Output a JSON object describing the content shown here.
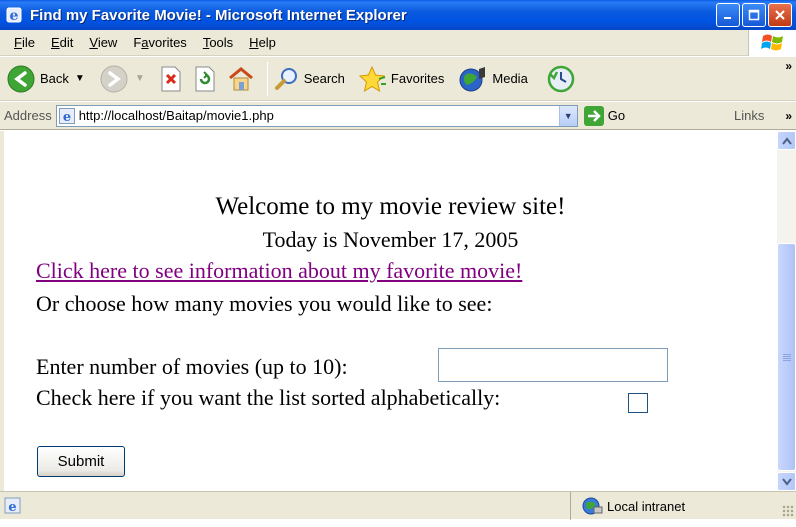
{
  "window": {
    "title": "Find my Favorite Movie! - Microsoft Internet Explorer"
  },
  "menu": {
    "items": [
      "File",
      "Edit",
      "View",
      "Favorites",
      "Tools",
      "Help"
    ],
    "mnemonics": [
      "F",
      "E",
      "V",
      "a",
      "T",
      "H"
    ]
  },
  "toolbar": {
    "back_label": "Back",
    "search_label": "Search",
    "favorites_label": "Favorites",
    "media_label": "Media"
  },
  "address": {
    "label": "Address",
    "url": "http://localhost/Baitap/movie1.php",
    "go_label": "Go",
    "links_label": "Links"
  },
  "page": {
    "welcome": "Welcome to my movie review site!",
    "today": "Today is November 17, 2005",
    "favorite_link": "Click here to see information about my favorite movie!",
    "choose": "Or choose how many movies you would like to see:",
    "enter_label": "Enter number of movies (up to 10):",
    "number_value": "",
    "sort_label": "Check here if you want the list sorted alphabetically:",
    "sort_checked": false,
    "submit_label": "Submit"
  },
  "status": {
    "zone": "Local intranet"
  },
  "colors": {
    "titlebar": "#0054e3",
    "visited_link": "#800080",
    "chrome": "#ece9d8"
  }
}
